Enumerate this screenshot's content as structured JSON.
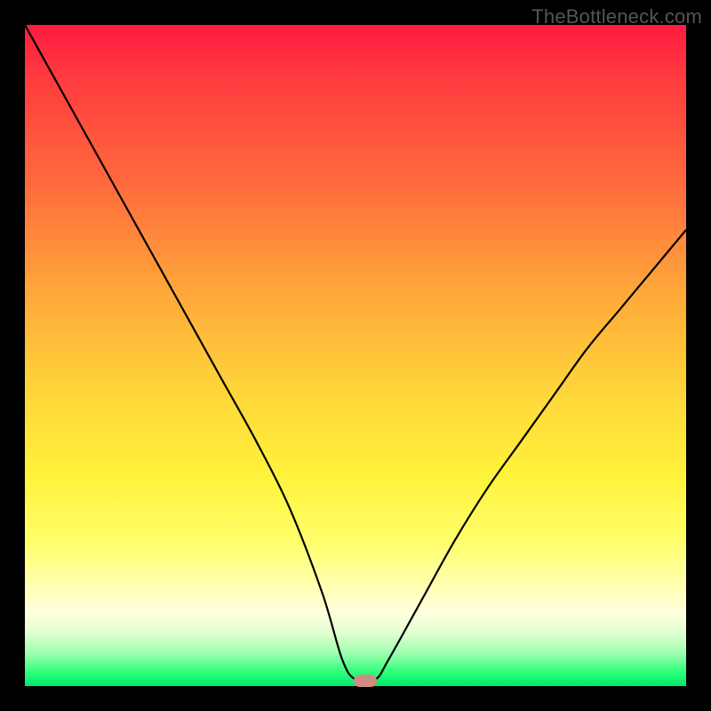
{
  "watermark": "TheBottleneck.com",
  "colors": {
    "curve_stroke": "#000000",
    "marker_fill": "#d18b82"
  },
  "chart_data": {
    "type": "line",
    "title": "",
    "xlabel": "",
    "ylabel": "",
    "xlim": [
      0,
      100
    ],
    "ylim": [
      0,
      100
    ],
    "grid": false,
    "series": [
      {
        "name": "bottleneck-curve",
        "x": [
          0,
          5,
          10,
          15,
          20,
          25,
          30,
          35,
          40,
          45,
          48,
          50,
          53,
          55,
          60,
          65,
          70,
          75,
          80,
          85,
          90,
          95,
          100
        ],
        "y": [
          100,
          91,
          82,
          73,
          64,
          55,
          46,
          37,
          27,
          14,
          4,
          1,
          1,
          4,
          13,
          22,
          30,
          37,
          44,
          51,
          57,
          63,
          69
        ]
      }
    ],
    "marker": {
      "x": 51.5,
      "y": 0.8
    }
  }
}
